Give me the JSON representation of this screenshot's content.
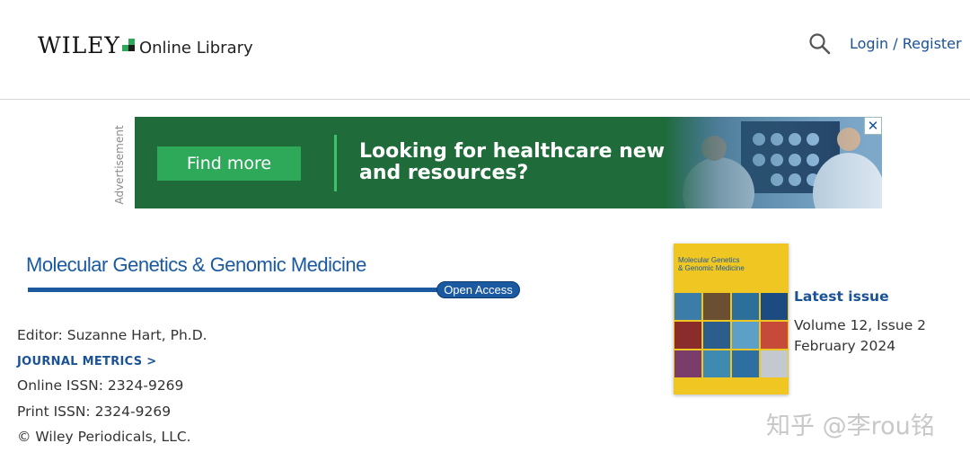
{
  "header": {
    "logo_brand": "WILEY",
    "logo_product": "Online Library",
    "login_label": "Login / Register",
    "search_icon": "search-icon"
  },
  "ad": {
    "label": "Advertisement",
    "button_label": "Find more",
    "headline_line1": "Looking for healthcare news",
    "headline_line2": "and resources?",
    "close_label": "✕",
    "colors": {
      "bg": "#1f6b3a",
      "button": "#2ea95a"
    }
  },
  "journal": {
    "title": "Molecular Genetics & Genomic Medicine",
    "badge": "Open Access",
    "editor": "Editor: Suzanne Hart, Ph.D.",
    "metrics_link": "JOURNAL METRICS >",
    "online_issn": "Online ISSN: 2324-9269",
    "print_issn": "Print ISSN: 2324-9269",
    "copyright": "© Wiley Periodicals, LLC."
  },
  "latest_issue": {
    "heading": "Latest issue",
    "volume_issue": "Volume 12, Issue 2",
    "date": "February 2024",
    "cover_title_line1": "Molecular Genetics",
    "cover_title_line2": "& Genomic Medicine",
    "cover_color": "#f0c623"
  },
  "watermark": "知乎 @李rou铭"
}
